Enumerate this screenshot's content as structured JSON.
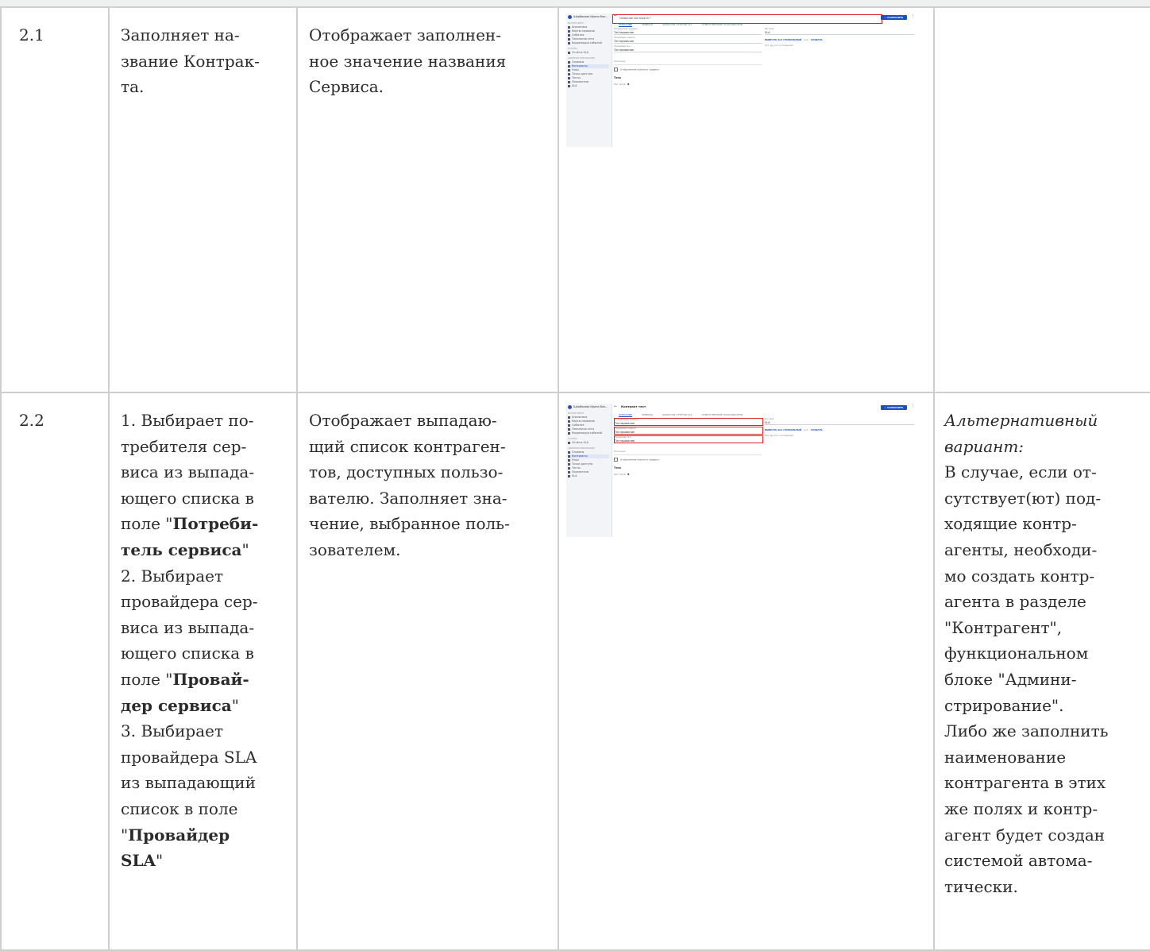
{
  "rows": [
    {
      "step": "2.1",
      "user_lines": [
        "Заполняет на-",
        "звание Контрак-",
        "та."
      ],
      "system_lines": [
        "Отображает заполнен-",
        "ное значение названия",
        "Сервиса."
      ]
    },
    {
      "step": "2.2",
      "user": {
        "l1": "1. Выбирает по-",
        "l2": "требителя сер-",
        "l3": "виса из выпада-",
        "l4": "ющего списка в",
        "l5_pre": "поле \"",
        "l5_b": "Потреби-",
        "l6_b": "тель сервиса",
        "l6_post": "\"",
        "l7": "2. Выбирает",
        "l8": "провайдера сер-",
        "l9": "виса из выпада-",
        "l10": "ющего списка в",
        "l11_pre": "поле \"",
        "l11_b": "Провай-",
        "l12_b": "дер сервиса",
        "l12_post": "\"",
        "l13": "3. Выбирает",
        "l14": "провайдера SLA",
        "l15": "из выпадающий",
        "l16": "список в поле",
        "l17_pre": "\"",
        "l17_b": "Провайдер",
        "l18_b": "SLA",
        "l18_post": "\""
      },
      "system_lines": [
        "Отображает выпадаю-",
        "щий список контраген-",
        "тов, доступных пользо-",
        "вателю. Заполняет зна-",
        "чение, выбранное поль-",
        "зователем."
      ],
      "note_title_lines": [
        "Альтернативный",
        "вариант:"
      ],
      "note_lines": [
        "В случае, если от-",
        "сутствует(ют) под-",
        "ходящие контр-",
        "агенты, необходи-",
        "мо создать контр-",
        "агента в разделе",
        "\"Контрагент\",",
        "функциональном",
        "блоке \"Админи-",
        "стрирование\".",
        "Либо же заполнить",
        "наименование",
        "контрагента в этих",
        "же полях и контр-",
        "агент будет создан",
        "системой автома-",
        "тически."
      ]
    }
  ],
  "mini_screenshot": {
    "user_name": "Щербакова Ирина Вал...",
    "nav_sections": [
      "МОНИТОРИНГ",
      "ОТЧЁТЫ",
      "АДМИНИСТРИРОВАНИЕ"
    ],
    "nav_items": [
      "Аналитика",
      "Карты сервисов",
      "События",
      "Топология сети",
      "Корреляция событий",
      "Отчёты SLA",
      "Сервисы",
      "Контракты",
      "Узлы",
      "Точки доступа",
      "Тесты",
      "Показатели",
      "SLA"
    ],
    "active_item": "Контракты",
    "title_placeholder": "Название контракта *",
    "title_value": "Контракт тест",
    "save_label": "✓ СОХРАНИТЬ",
    "tabs": [
      "ОПИСАНИЕ",
      "СЕРВИСЫ",
      "ШАБЛОНЫ ОТЧЁТОВ SLA",
      "ОТВЕТСТВЕННЫЕ ПОЛЬЗОВАТЕЛИ"
    ],
    "fields": [
      {
        "label": "Потребитель сервиса",
        "value": "Тестирование"
      },
      {
        "label": "Провайдер сервиса",
        "value": "Тестирование"
      },
      {
        "label": "Провайдер SLA",
        "value": "Тестирование"
      }
    ],
    "right_field": {
      "label": "Договор",
      "value": "SLA"
    },
    "link_select": "ВЫБРАТЬ SLA ГЛОБАЛЬНЫЙ",
    "link_or": "или",
    "link_create": "СОЗДАТЬ",
    "no_sla_text": "Нет других соглашений",
    "description_label": "Описание",
    "checkbox_label": "Отображение обычного графика",
    "tags_heading": "Теги",
    "no_tags": "Нет тегов"
  }
}
